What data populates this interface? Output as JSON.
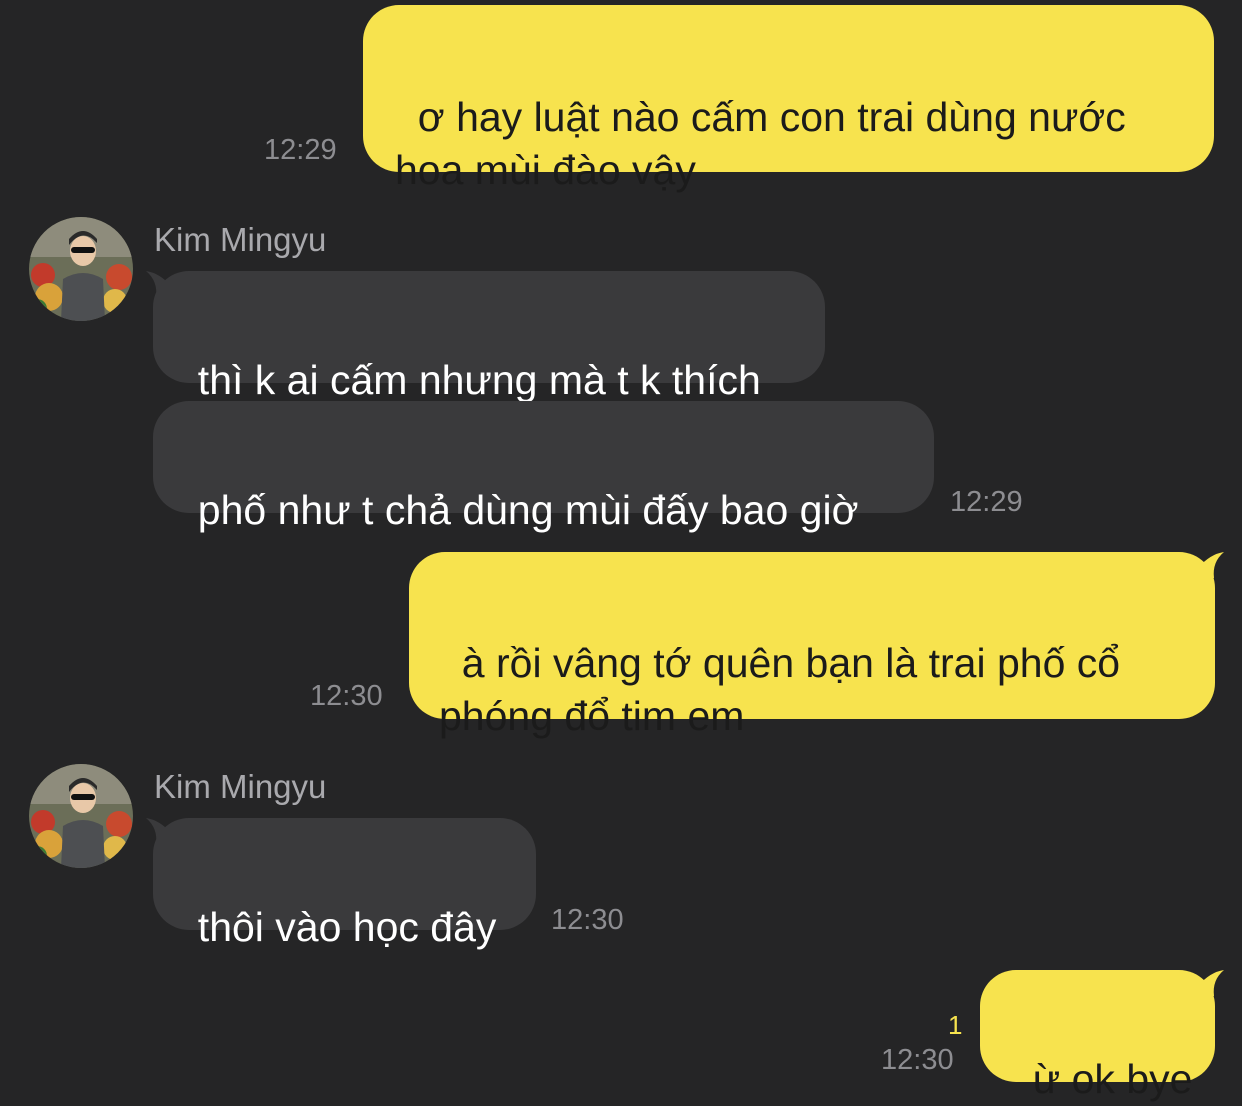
{
  "messages": [
    {
      "direction": "outgoing",
      "text": "ơ hay luật nào cấm con trai dùng nước\nhoa mùi đào vậy",
      "time": "12:29"
    },
    {
      "direction": "incoming",
      "sender": "Kim Mingyu",
      "text": "thì k ai cấm nhưng mà t k thích"
    },
    {
      "direction": "incoming",
      "text": "phố như t chả dùng mùi đấy bao giờ",
      "time": "12:29"
    },
    {
      "direction": "outgoing",
      "text": "à rồi vâng tớ quên bạn là trai phố cổ\nphóng đổ tim em",
      "time": "12:30"
    },
    {
      "direction": "incoming",
      "sender": "Kim Mingyu",
      "text": "thôi vào học đây",
      "time": "12:30"
    },
    {
      "direction": "outgoing",
      "text": "ừ ok bye",
      "time": "12:30",
      "unread_count": "1"
    }
  ],
  "icons": {
    "avatar": "profile-photo-avatar"
  },
  "colors": {
    "background": "#252526",
    "outgoing_bubble": "#f7e34e",
    "incoming_bubble": "#3a3a3c",
    "timestamp": "#8d8d91",
    "unread_indicator": "#f7e34e"
  }
}
